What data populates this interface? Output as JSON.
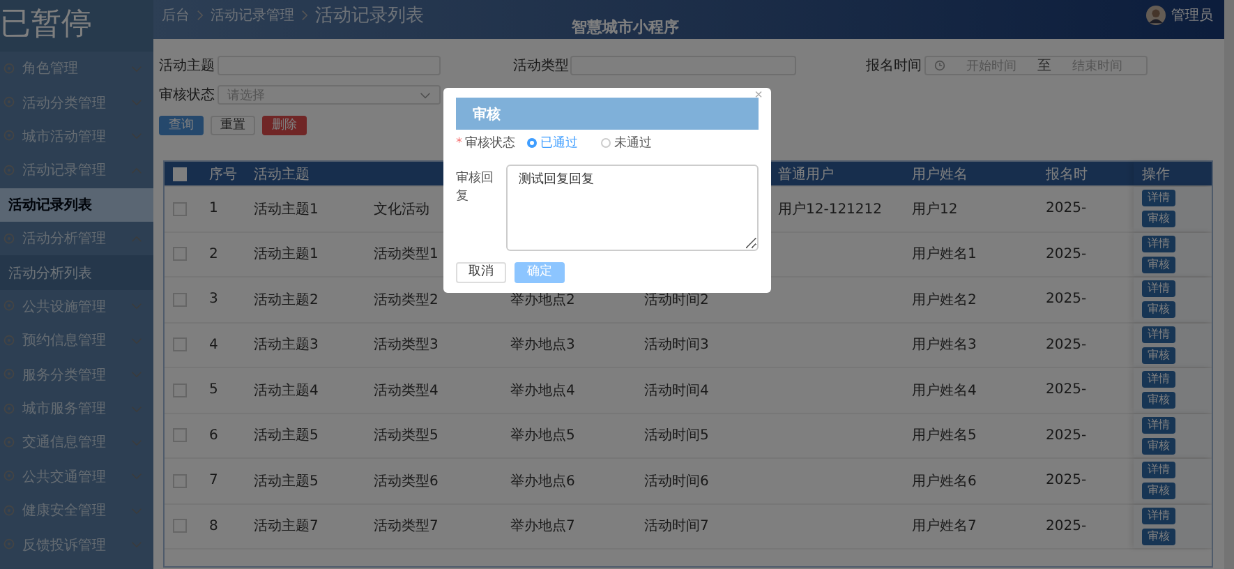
{
  "sidebar": {
    "title": "已暂停",
    "items": [
      {
        "label": "角色管理",
        "expanded": false
      },
      {
        "label": "活动分类管理",
        "expanded": false
      },
      {
        "label": "城市活动管理",
        "expanded": false
      },
      {
        "label": "活动记录管理",
        "expanded": true,
        "children": [
          {
            "label": "活动记录列表",
            "selected": true
          }
        ]
      },
      {
        "label": "活动分析管理",
        "expanded": true,
        "children": [
          {
            "label": "活动分析列表",
            "selected": false
          }
        ]
      },
      {
        "label": "公共设施管理",
        "expanded": false
      },
      {
        "label": "预约信息管理",
        "expanded": false
      },
      {
        "label": "服务分类管理",
        "expanded": false
      },
      {
        "label": "城市服务管理",
        "expanded": false
      },
      {
        "label": "交通信息管理",
        "expanded": false
      },
      {
        "label": "公共交通管理",
        "expanded": false
      },
      {
        "label": "健康安全管理",
        "expanded": false
      },
      {
        "label": "反馈投诉管理",
        "expanded": false
      }
    ]
  },
  "header": {
    "breadcrumb": [
      "后台",
      "活动记录管理",
      "活动记录列表"
    ],
    "app_title": "智慧城市小程序",
    "user": "管理员"
  },
  "filters": {
    "topic_label": "活动主题",
    "type_label": "活动类型",
    "date_label": "报名时间",
    "date_start_placeholder": "开始时间",
    "date_separator": "至",
    "date_end_placeholder": "结束时间",
    "status_label": "审核状态",
    "status_placeholder": "请选择",
    "buttons": [
      {
        "label": "查询",
        "kind": "primary"
      },
      {
        "label": "重置",
        "kind": "plain"
      },
      {
        "label": "删除",
        "kind": "danger"
      }
    ]
  },
  "table": {
    "columns": {
      "seq": "序号",
      "topic": "活动主题",
      "user": "普通用户",
      "name": "用户姓名",
      "date": "报名时",
      "ops": "操作"
    },
    "header_checked": false,
    "rows": [
      {
        "checked": false,
        "seq": "1",
        "topic": "活动主题1",
        "type": "文化活动",
        "user": "用户12-121212",
        "name": "用户12",
        "date": "2025-",
        "buttons": [
          "详情",
          "审核"
        ]
      },
      {
        "checked": false,
        "seq": "2",
        "topic": "活动主题1",
        "type": "活动类型1",
        "name": "用户姓名1",
        "date": "2025-",
        "buttons": [
          "详情",
          "审核"
        ]
      },
      {
        "checked": false,
        "seq": "3",
        "topic": "活动主题2",
        "type": "活动类型2",
        "place": "举办地点2",
        "time": "活动时间2",
        "name": "用户姓名2",
        "date": "2025-",
        "buttons": [
          "详情",
          "审核"
        ]
      },
      {
        "checked": false,
        "seq": "4",
        "topic": "活动主题3",
        "type": "活动类型3",
        "place": "举办地点3",
        "time": "活动时间3",
        "name": "用户姓名3",
        "date": "2025-",
        "buttons": [
          "详情",
          "审核"
        ]
      },
      {
        "checked": false,
        "seq": "5",
        "topic": "活动主题4",
        "type": "活动类型4",
        "place": "举办地点4",
        "time": "活动时间4",
        "name": "用户姓名4",
        "date": "2025-",
        "buttons": [
          "详情",
          "审核"
        ]
      },
      {
        "checked": false,
        "seq": "6",
        "topic": "活动主题5",
        "type": "活动类型5",
        "place": "举办地点5",
        "time": "活动时间5",
        "name": "用户姓名5",
        "date": "2025-",
        "buttons": [
          "详情",
          "审核"
        ]
      },
      {
        "checked": false,
        "seq": "7",
        "topic": "活动主题5",
        "type": "活动类型6",
        "place": "举办地点6",
        "time": "活动时间6",
        "name": "用户姓名6",
        "date": "2025-",
        "buttons": [
          "详情",
          "审核"
        ]
      },
      {
        "checked": false,
        "seq": "8",
        "topic": "活动主题7",
        "type": "活动类型7",
        "place": "举办地点7",
        "time": "活动时间7",
        "name": "用户姓名7",
        "date": "2025-",
        "buttons": [
          "详情",
          "审核"
        ]
      }
    ]
  },
  "dialog": {
    "title": "审核",
    "close": "×",
    "required_mark": "*",
    "status_label": "审核状态",
    "options": [
      {
        "label": "已通过",
        "selected": true
      },
      {
        "label": "未通过",
        "selected": false
      }
    ],
    "reply_label": "审核回复",
    "reply_value": "测试回复回复",
    "buttons": [
      {
        "label": "取消",
        "kind": "plain"
      },
      {
        "label": "确定",
        "kind": "primary"
      }
    ]
  }
}
